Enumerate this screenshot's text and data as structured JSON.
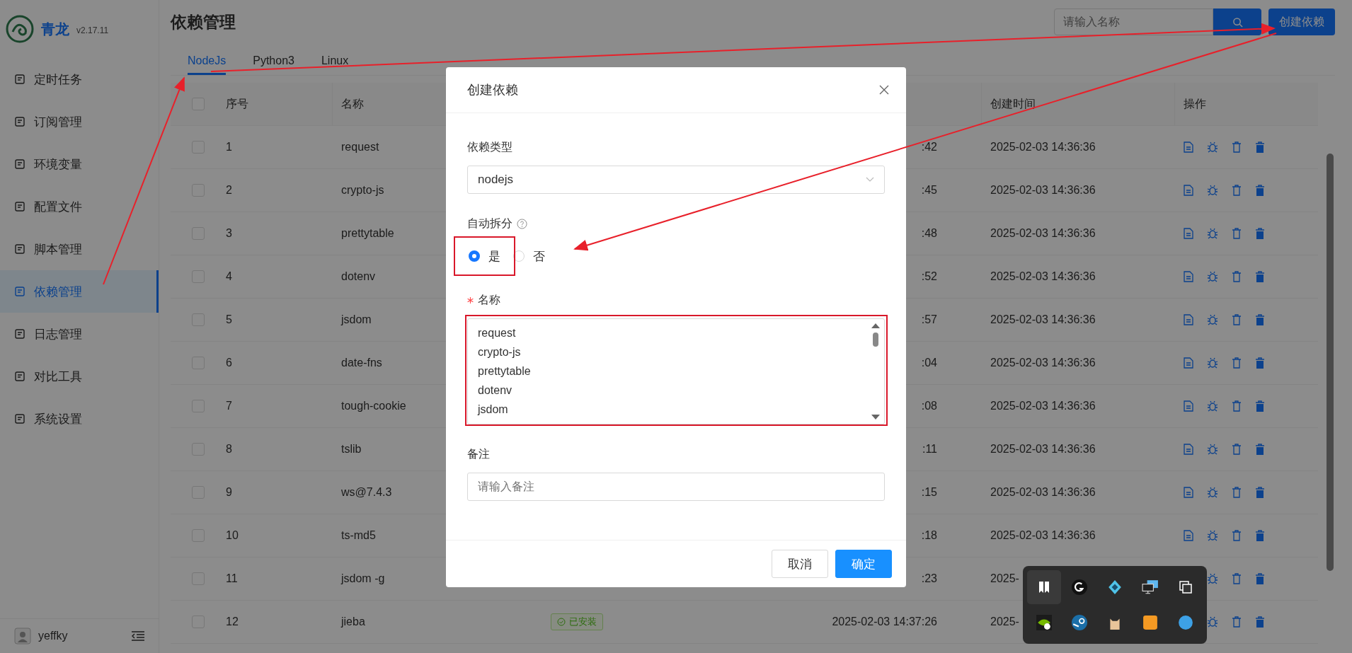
{
  "app": {
    "name": "青龙",
    "version": "v2.17.11"
  },
  "sidebar": {
    "items": [
      {
        "label": "定时任务",
        "selected": false
      },
      {
        "label": "订阅管理",
        "selected": false
      },
      {
        "label": "环境变量",
        "selected": false
      },
      {
        "label": "配置文件",
        "selected": false
      },
      {
        "label": "脚本管理",
        "selected": false
      },
      {
        "label": "依赖管理",
        "selected": true
      },
      {
        "label": "日志管理",
        "selected": false
      },
      {
        "label": "对比工具",
        "selected": false
      },
      {
        "label": "系统设置",
        "selected": false
      }
    ],
    "user": {
      "name": "yeffky"
    }
  },
  "header": {
    "title": "依赖管理",
    "search": {
      "placeholder": "请输入名称"
    },
    "create_button": "创建依赖"
  },
  "tabs": [
    {
      "label": "NodeJs",
      "selected": true
    },
    {
      "label": "Python3",
      "selected": false
    },
    {
      "label": "Linux",
      "selected": false
    }
  ],
  "table": {
    "headers": {
      "index": "序号",
      "name": "名称",
      "created": "创建时间",
      "actions": "操作"
    },
    "all_checked": false,
    "rows": [
      {
        "checked": false,
        "index": "1",
        "name": "request",
        "updated": ":42",
        "created": "2025-02-03 14:36:36"
      },
      {
        "checked": false,
        "index": "2",
        "name": "crypto-js",
        "updated": ":45",
        "created": "2025-02-03 14:36:36"
      },
      {
        "checked": false,
        "index": "3",
        "name": "prettytable",
        "updated": ":48",
        "created": "2025-02-03 14:36:36"
      },
      {
        "checked": false,
        "index": "4",
        "name": "dotenv",
        "updated": ":52",
        "created": "2025-02-03 14:36:36"
      },
      {
        "checked": false,
        "index": "5",
        "name": "jsdom",
        "updated": ":57",
        "created": "2025-02-03 14:36:36"
      },
      {
        "checked": false,
        "index": "6",
        "name": "date-fns",
        "updated": ":04",
        "created": "2025-02-03 14:36:36"
      },
      {
        "checked": false,
        "index": "7",
        "name": "tough-cookie",
        "updated": ":08",
        "created": "2025-02-03 14:36:36"
      },
      {
        "checked": false,
        "index": "8",
        "name": "tslib",
        "updated": ":11",
        "created": "2025-02-03 14:36:36"
      },
      {
        "checked": false,
        "index": "9",
        "name": "ws@7.4.3",
        "updated": ":15",
        "created": "2025-02-03 14:36:36"
      },
      {
        "checked": false,
        "index": "10",
        "name": "ts-md5",
        "updated": ":18",
        "created": "2025-02-03 14:36:36"
      },
      {
        "checked": false,
        "index": "11",
        "name": "jsdom -g",
        "updated": ":23",
        "created": "2025-",
        "actions_covered": true
      },
      {
        "checked": false,
        "index": "12",
        "name": "jieba",
        "status": "已安装",
        "updated": "2025-02-03 14:37:26",
        "created": "2025-",
        "actions_covered": true
      }
    ]
  },
  "modal": {
    "title": "创建依赖",
    "fields": [
      {
        "kind": "select",
        "label": "依赖类型",
        "value": "nodejs"
      },
      {
        "kind": "radio",
        "label": "自动拆分",
        "help": true,
        "options": [
          {
            "label": "是",
            "selected": true
          },
          {
            "label": "否",
            "selected": false
          }
        ]
      },
      {
        "kind": "textarea",
        "label": "名称",
        "required": true,
        "lines": [
          "request",
          "crypto-js",
          "prettytable",
          "dotenv",
          "jsdom"
        ]
      },
      {
        "kind": "input",
        "label": "备注",
        "placeholder": "请输入备注"
      }
    ],
    "buttons": [
      {
        "label": "取消",
        "kind": "default"
      },
      {
        "label": "确定",
        "kind": "primary"
      }
    ]
  }
}
